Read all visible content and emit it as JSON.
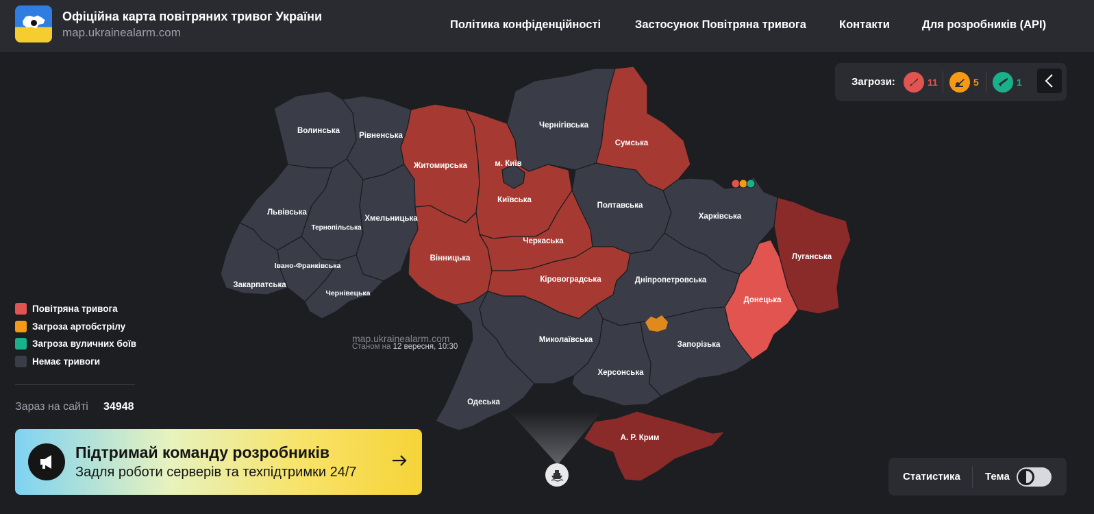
{
  "header": {
    "title": "Офіційна карта повітряних тривог України",
    "subtitle": "map.ukrainealarm.com",
    "nav": [
      {
        "label": "Політика конфіденційності"
      },
      {
        "label": "Застосунок Повітряна тривога"
      },
      {
        "label": "Контакти"
      },
      {
        "label": "Для розробників (API)"
      }
    ]
  },
  "threats": {
    "label": "Загрози:",
    "items": [
      {
        "icon": "missile-icon",
        "count": "11",
        "color": "#e2544f"
      },
      {
        "icon": "artillery-icon",
        "count": "5",
        "color": "#f59a16"
      },
      {
        "icon": "rifle-icon",
        "count": "1",
        "color": "#19b08a"
      }
    ]
  },
  "legend": [
    {
      "label": "Повітряна тривога",
      "color": "#e2544f"
    },
    {
      "label": "Загроза артобстрілу",
      "color": "#f59a16"
    },
    {
      "label": "Загроза вуличних боїв",
      "color": "#19b08a"
    },
    {
      "label": "Немає тривоги",
      "color": "#3a3d48"
    }
  ],
  "online": {
    "label": "Зараз на сайті",
    "count": "34948"
  },
  "banner": {
    "title": "Підтримай команду розробників",
    "subtitle": "Задля роботи серверів та техпідтримки 24/7"
  },
  "stamp": {
    "site": "map.ukrainealarm.com",
    "prefix": "Станом на",
    "datetime": "12 вересня, 10:30"
  },
  "regions": [
    {
      "name": "Волинська",
      "status": "none"
    },
    {
      "name": "Рівненська",
      "status": "none"
    },
    {
      "name": "Житомирська",
      "status": "alert"
    },
    {
      "name": "м. Київ",
      "status": "alert"
    },
    {
      "name": "Чернігівська",
      "status": "none"
    },
    {
      "name": "Сумська",
      "status": "alert"
    },
    {
      "name": "Львівська",
      "status": "none"
    },
    {
      "name": "Тернопільська",
      "status": "none"
    },
    {
      "name": "Хмельницька",
      "status": "none"
    },
    {
      "name": "Київська",
      "status": "alert"
    },
    {
      "name": "Полтавська",
      "status": "none"
    },
    {
      "name": "Харківська",
      "status": "none"
    },
    {
      "name": "Луганська",
      "status": "alert"
    },
    {
      "name": "Черкаська",
      "status": "alert"
    },
    {
      "name": "Вінницька",
      "status": "alert"
    },
    {
      "name": "Івано-Франківська",
      "status": "none"
    },
    {
      "name": "Закарпатська",
      "status": "none"
    },
    {
      "name": "Чернівецька",
      "status": "none"
    },
    {
      "name": "Кіровоградська",
      "status": "alert"
    },
    {
      "name": "Дніпропетровська",
      "status": "none"
    },
    {
      "name": "Донецька",
      "status": "alert"
    },
    {
      "name": "Миколаївська",
      "status": "none"
    },
    {
      "name": "Запорізька",
      "status": "none"
    },
    {
      "name": "Херсонська",
      "status": "none"
    },
    {
      "name": "Одеська",
      "status": "none"
    },
    {
      "name": "А. Р. Крим",
      "status": "alert"
    }
  ],
  "colors": {
    "none": "#3a3d48",
    "alert_dark": "#8b2b29",
    "alert_mid": "#a63a32",
    "alert_light": "#e2544f",
    "artillery": "#e08a1e"
  },
  "controls": {
    "statistics": "Статистика",
    "theme": "Тема"
  }
}
